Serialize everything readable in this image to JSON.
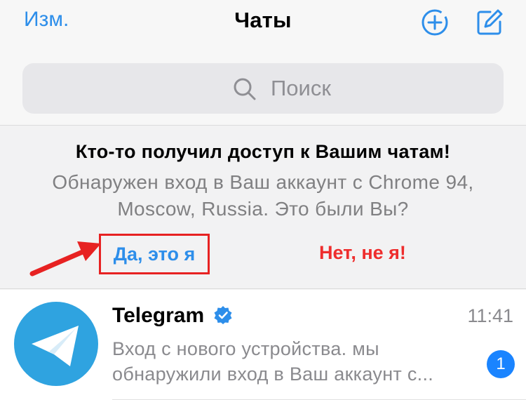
{
  "header": {
    "edit_label": "Изм.",
    "title": "Чаты",
    "new_group_icon": "plus-circle-icon",
    "compose_icon": "compose-icon"
  },
  "search": {
    "placeholder": "Поиск",
    "icon": "search-icon"
  },
  "banner": {
    "title": "Кто-то получил доступ к Вашим чатам!",
    "body": "Обнаружен вход в Ваш аккаунт с Chrome 94, Moscow, Russia. Это были Вы?",
    "confirm_label": "Да, это я",
    "deny_label": "Нет, не я!"
  },
  "chats": [
    {
      "name": "Telegram",
      "verified": true,
      "time": "11:41",
      "message_line1": "Вход с нового устройства.             мы",
      "message_line2": "обнаружили вход в Ваш аккаунт с...",
      "unread_count": "1"
    }
  ],
  "colors": {
    "accent": "#2d8eea",
    "danger": "#ee2d2d",
    "highlight_border": "#e72222",
    "unread_badge": "#1a84ff",
    "avatar": "#2fa3e0"
  }
}
